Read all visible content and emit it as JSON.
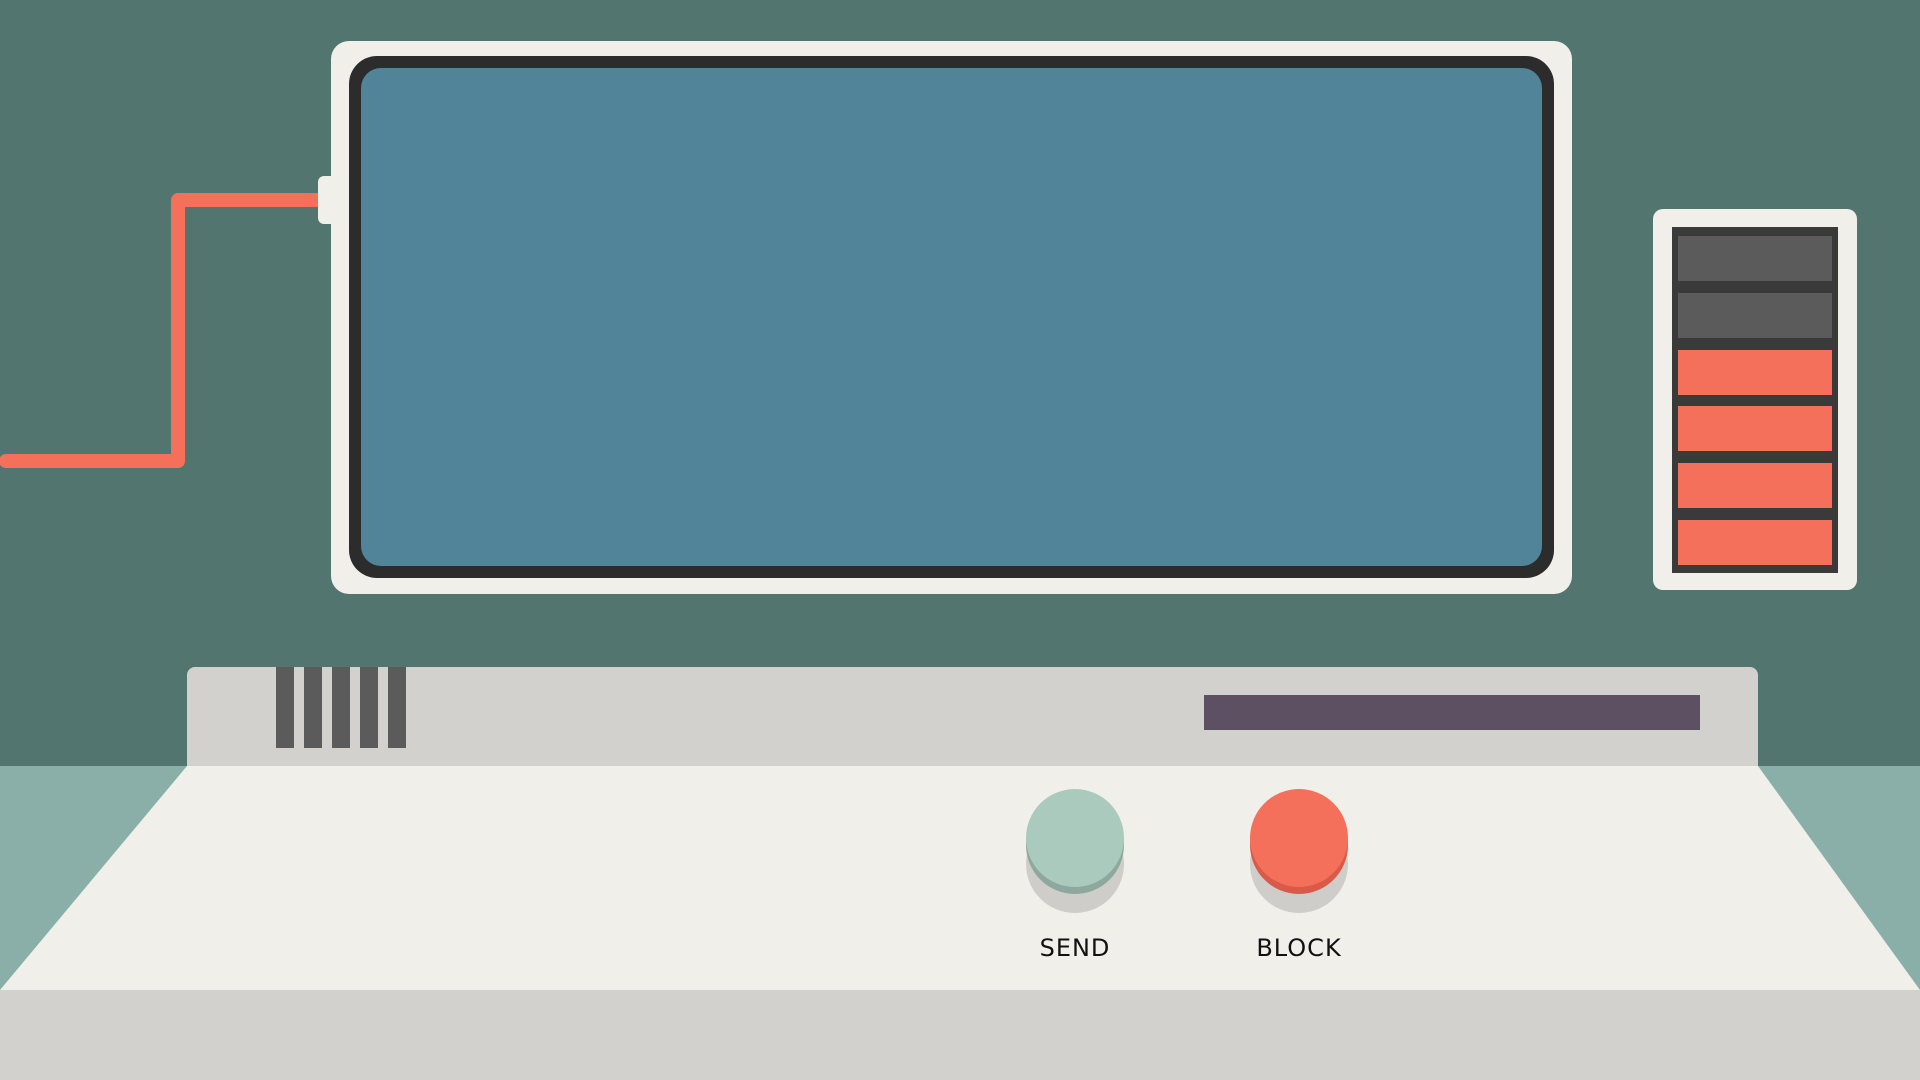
{
  "colors": {
    "wall": "#537570",
    "floor": "#8aafa9",
    "monitor_frame": "#f1efe9",
    "monitor_bezel": "#2c2c2c",
    "screen": "#518399",
    "cable": "#f4705a",
    "meter_off": "#5b5b5b",
    "meter_on": "#f4705a",
    "console_back": "#d2d1cd",
    "console_top": "#f1efe9",
    "card_slot": "#5e5063",
    "send_button": "#a9cabd",
    "send_rim": "#8fa89e",
    "block_button": "#f4705a",
    "block_rim": "#d85a48"
  },
  "level_meter": {
    "total_cells": 6,
    "lit_cells": 4
  },
  "buttons": {
    "send_label": "SEND",
    "block_label": "BLOCK"
  }
}
